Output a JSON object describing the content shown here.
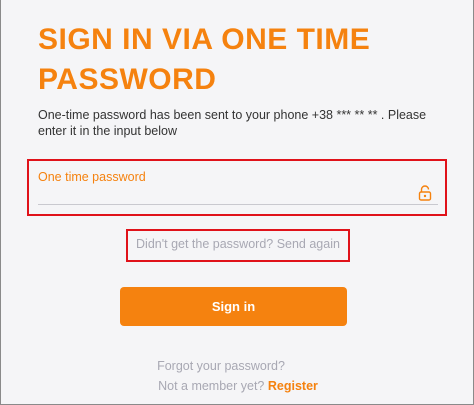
{
  "page": {
    "title": "SIGN IN VIA ONE TIME PASSWORD",
    "subtitle": "One-time password has been sent to your phone +38 *** ** ** . Please enter it in the input below"
  },
  "otp_field": {
    "label": "One time password",
    "value": "",
    "icon": "lock-icon"
  },
  "resend": {
    "label": "Didn't get the password? Send again"
  },
  "signin": {
    "label": "Sign in"
  },
  "footer": {
    "forgot_label": "Forgot your password?",
    "member_prompt": "Not a member yet?",
    "register_label": "Register"
  },
  "colors": {
    "accent": "#f5820f",
    "highlight": "#e0121a",
    "muted": "#a8a8b3"
  }
}
